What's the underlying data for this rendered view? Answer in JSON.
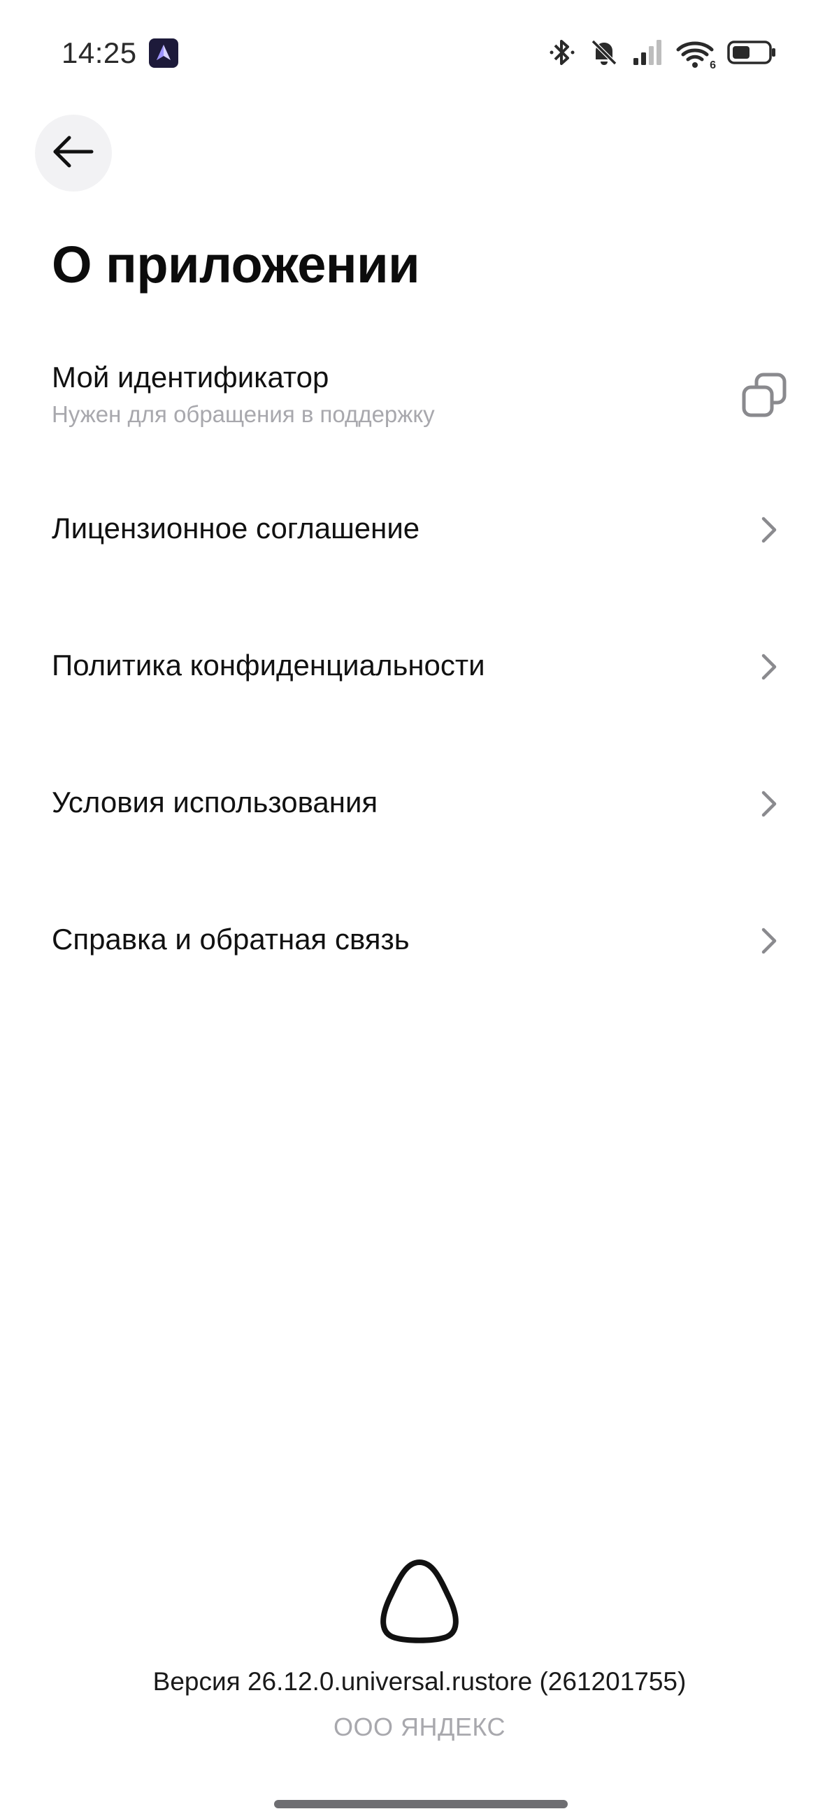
{
  "status_bar": {
    "time": "14:25",
    "app_icon": "aurora-app-icon",
    "icons": [
      "bluetooth-icon",
      "bell-off-icon",
      "cellular-signal-icon",
      "wifi-icon",
      "battery-icon"
    ],
    "wifi_badge": "6"
  },
  "header": {
    "back_icon": "arrow-left-icon",
    "title": "О приложении"
  },
  "menu": {
    "identifier": {
      "label": "Мой идентификатор",
      "sublabel": "Нужен для обращения в поддержку",
      "action_icon": "copy-icon"
    },
    "items": [
      {
        "label": "Лицензионное соглашение",
        "icon": "chevron-right-icon"
      },
      {
        "label": "Политика конфиденциальности",
        "icon": "chevron-right-icon"
      },
      {
        "label": "Условия использования",
        "icon": "chevron-right-icon"
      },
      {
        "label": "Справка и обратная связь",
        "icon": "chevron-right-icon"
      }
    ]
  },
  "footer": {
    "logo": "alice-logo-icon",
    "version": "Версия 26.12.0.universal.rustore (261201755)",
    "company": "ООО ЯНДЕКС"
  },
  "colors": {
    "background": "#ffffff",
    "text_primary": "#111111",
    "text_secondary": "#a8a8ad",
    "back_button_bg": "#f2f2f4",
    "chevron": "#8a8a8e"
  }
}
